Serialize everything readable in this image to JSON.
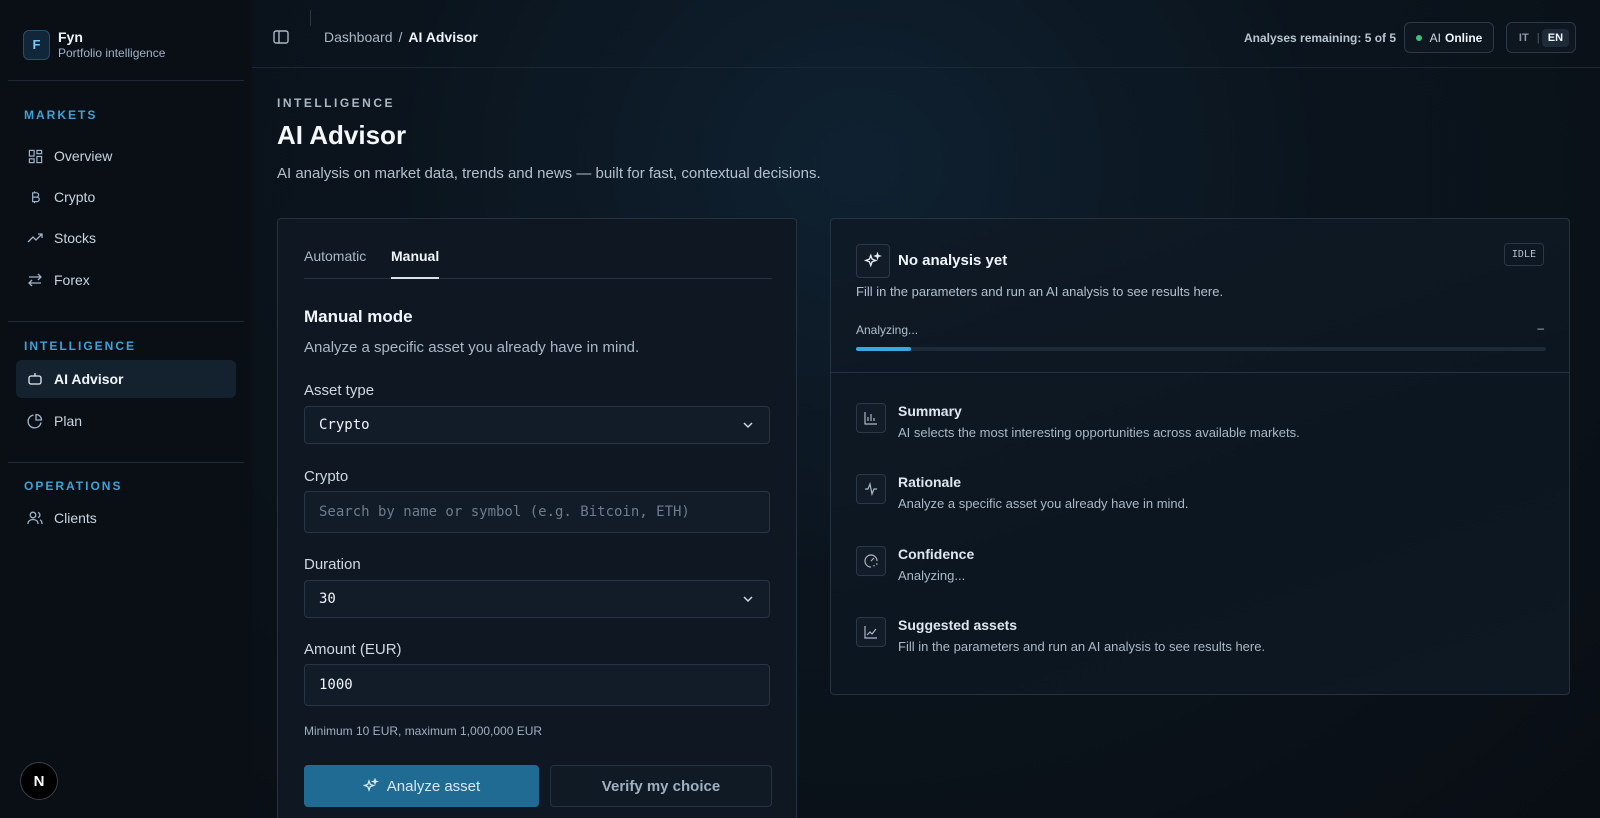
{
  "brand": {
    "logo_letter": "F",
    "name": "Fyn",
    "subtitle": "Portfolio intelligence"
  },
  "sidebar": {
    "sections": [
      {
        "title": "MARKETS",
        "items": [
          "Overview",
          "Crypto",
          "Stocks",
          "Forex"
        ]
      },
      {
        "title": "INTELLIGENCE",
        "items": [
          "AI Advisor",
          "Plan"
        ]
      },
      {
        "title": "OPERATIONS",
        "items": [
          "Clients"
        ]
      }
    ],
    "active_item": "AI Advisor",
    "badge": "N"
  },
  "topbar": {
    "breadcrumb": [
      "Dashboard",
      "AI Advisor"
    ],
    "remaining": "Analyses remaining: 5 of 5",
    "ai_status": {
      "prefix": "AI",
      "state": "Online"
    },
    "languages": [
      "IT",
      "EN"
    ],
    "active_language": "EN"
  },
  "page": {
    "kicker": "INTELLIGENCE",
    "title": "AI Advisor",
    "description": "AI analysis on market data, trends and news — built for fast, contextual decisions."
  },
  "form": {
    "tabs": [
      "Automatic",
      "Manual"
    ],
    "active_tab": "Manual",
    "title": "Manual mode",
    "description": "Analyze a specific asset you already have in mind.",
    "asset_type": {
      "label": "Asset type",
      "value": "Crypto"
    },
    "crypto": {
      "label": "Crypto",
      "placeholder": "Search by name or symbol (e.g. Bitcoin, ETH)"
    },
    "duration": {
      "label": "Duration",
      "value": "30"
    },
    "amount": {
      "label": "Amount (EUR)",
      "value": "1000",
      "hint": "Minimum 10 EUR, maximum 1,000,000 EUR"
    },
    "primary_button": "Analyze asset",
    "secondary_button": "Verify my choice"
  },
  "result": {
    "title": "No analysis yet",
    "subtitle": "Fill in the parameters and run an AI analysis to see results here.",
    "status": "IDLE",
    "progress_label": "Analyzing...",
    "progress_value_text": "–",
    "progress_fraction": 0.08,
    "rows": [
      {
        "icon": "bar-chart-icon",
        "title": "Summary",
        "text": "AI selects the most interesting opportunities across available markets."
      },
      {
        "icon": "activity-icon",
        "title": "Rationale",
        "text": "Analyze a specific asset you already have in mind."
      },
      {
        "icon": "gauge-icon",
        "title": "Confidence",
        "text": "Analyzing..."
      },
      {
        "icon": "line-chart-icon",
        "title": "Suggested assets",
        "text": "Fill in the parameters and run an AI analysis to see results here."
      }
    ]
  },
  "colors": {
    "accent": "#36a9e1",
    "section": "#3aa3d8",
    "online": "#3fbf7f",
    "primary_button": "#1f6b93"
  }
}
